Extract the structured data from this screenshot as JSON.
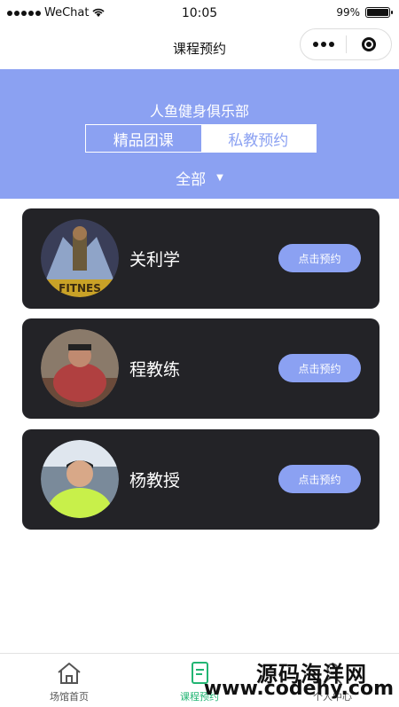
{
  "status_bar": {
    "carrier": "WeChat",
    "time": "10:05",
    "battery": "99%"
  },
  "navbar": {
    "title": "课程预约"
  },
  "header": {
    "club_name": "人鱼健身俱乐部",
    "tabs": [
      {
        "label": "精品团课",
        "active": true
      },
      {
        "label": "私教预约",
        "active": false
      }
    ],
    "filter": "全部"
  },
  "coaches": [
    {
      "name": "关利学",
      "button": "点击预约"
    },
    {
      "name": "程教练",
      "button": "点击预约"
    },
    {
      "name": "杨教授",
      "button": "点击预约"
    }
  ],
  "tabbar": [
    {
      "label": "场馆首页",
      "icon": "home-icon",
      "active": false
    },
    {
      "label": "课程预约",
      "icon": "document-icon",
      "active": true
    },
    {
      "label": "个人中心",
      "icon": "person-icon",
      "active": false
    }
  ],
  "watermark": {
    "text": "源码海洋网",
    "url": "www.codehy.com"
  },
  "colors": {
    "accent": "#8ba1f2",
    "card_bg": "#232327",
    "tab_active": "#22b573"
  }
}
